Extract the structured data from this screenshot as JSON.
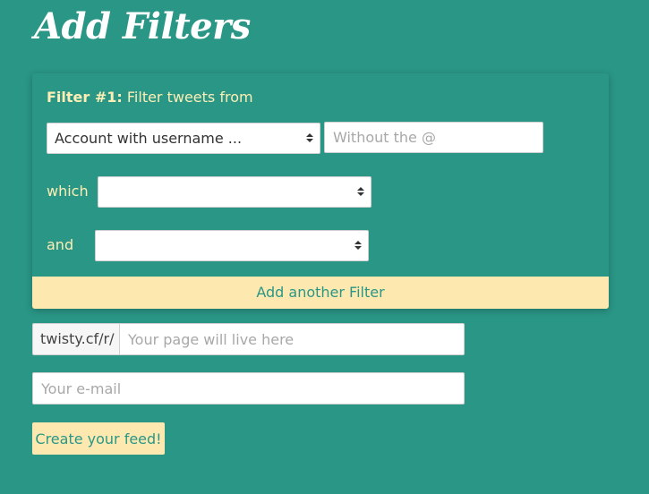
{
  "page": {
    "title": "Add Filters"
  },
  "filter": {
    "number_label": "Filter #1:",
    "heading_text": " Filter tweets from",
    "source_select_value": "Account with username ...",
    "username_placeholder": "Without the @",
    "which_label": "which",
    "which_select_value": "",
    "and_label": "and",
    "and_select_value": ""
  },
  "add_filter_label": "Add another Filter",
  "feed": {
    "url_prefix": "twisty.cf/r/",
    "page_placeholder": "Your page will live here",
    "email_placeholder": "Your e-mail",
    "create_label": "Create your feed!"
  }
}
